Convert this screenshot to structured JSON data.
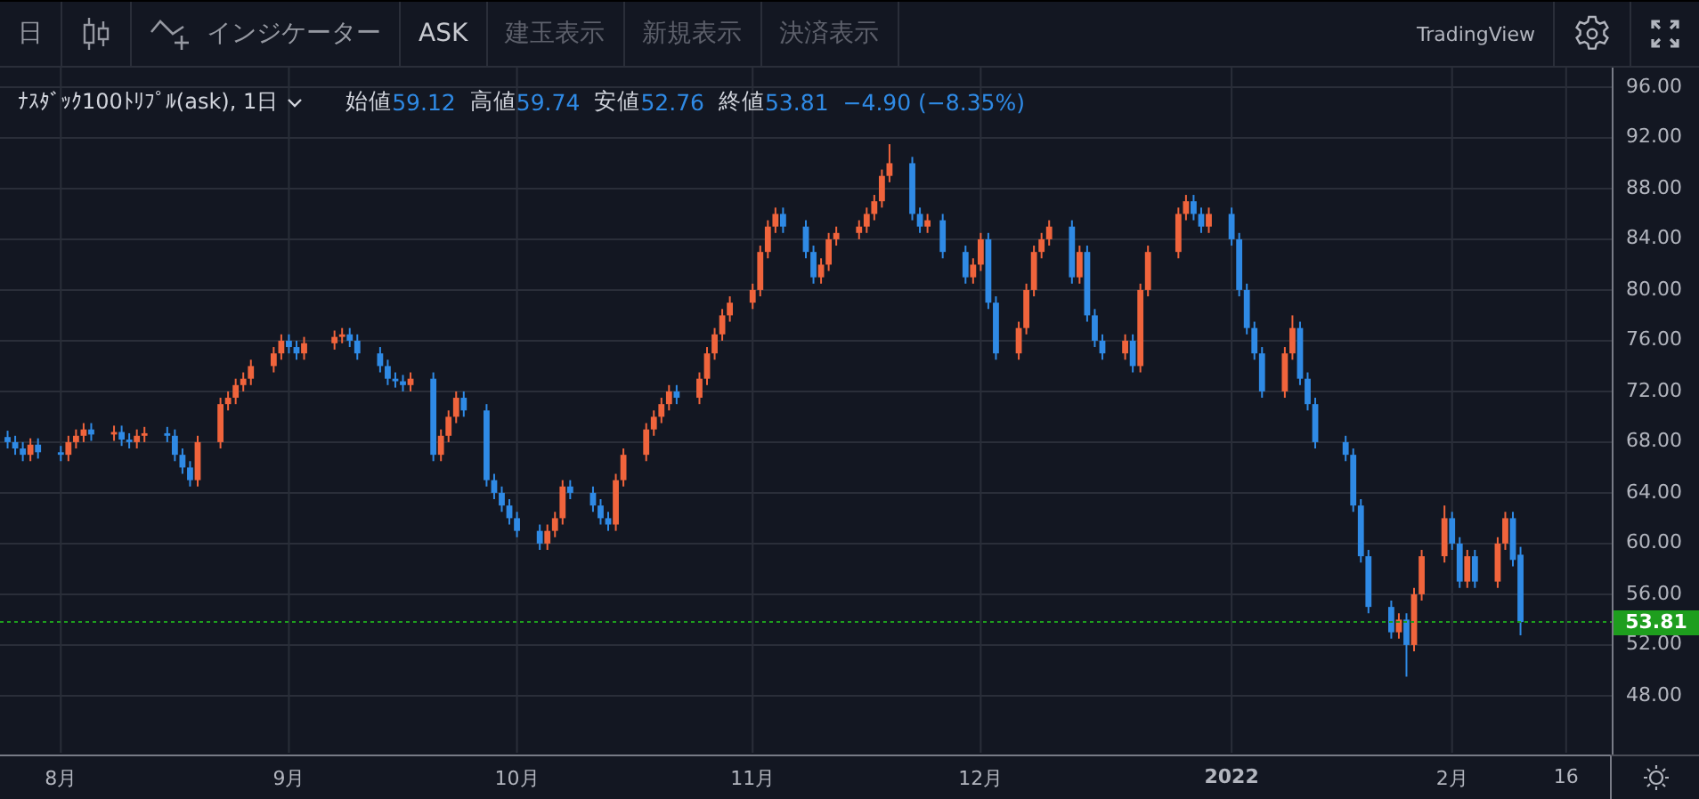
{
  "toolbar": {
    "items": [
      {
        "kind": "text",
        "label": "日"
      },
      {
        "kind": "icon"
      },
      {
        "kind": "indicator",
        "label": "インジケーター"
      },
      {
        "kind": "toggle",
        "label": "ASK",
        "selected": true
      },
      {
        "kind": "toggle",
        "label": "建玉表示",
        "selected": false
      },
      {
        "kind": "toggle",
        "label": "新規表示",
        "selected": false
      },
      {
        "kind": "toggle",
        "label": "決済表示",
        "selected": false
      }
    ],
    "brand": "TradingView"
  },
  "legend": {
    "symbol": "ﾅｽﾀﾞｯｸ100ﾄﾘﾌﾟﾙ(ask), 1日",
    "fields": [
      {
        "label": "始値",
        "value": "59.12"
      },
      {
        "label": "高値",
        "value": "59.74"
      },
      {
        "label": "安値",
        "value": "52.76"
      },
      {
        "label": "終値",
        "value": "53.81"
      }
    ],
    "change": "−4.90 (−8.35%)"
  },
  "chart_data": {
    "type": "candlestick",
    "xlim": [
      "2021-07-25",
      "2022-02-22"
    ],
    "ylim": [
      43.5,
      97.54
    ],
    "grid": true,
    "ref_lines": [
      {
        "axis": "y",
        "value": 53.81,
        "label": "53.81",
        "color": "#1e9e1e"
      }
    ],
    "yticks": [
      {
        "value": 48,
        "label": "48.00"
      },
      {
        "value": 52,
        "label": "52.00"
      },
      {
        "value": 56,
        "label": "56.00"
      },
      {
        "value": 60,
        "label": "60.00"
      },
      {
        "value": 64,
        "label": "64.00"
      },
      {
        "value": 68,
        "label": "68.00"
      },
      {
        "value": 72,
        "label": "72.00"
      },
      {
        "value": 76,
        "label": "76.00"
      },
      {
        "value": 80,
        "label": "80.00"
      },
      {
        "value": 84,
        "label": "84.00"
      },
      {
        "value": 88,
        "label": "88.00"
      },
      {
        "value": 92,
        "label": "92.00"
      },
      {
        "value": 96,
        "label": "96.00"
      }
    ],
    "xticks": [
      {
        "value": "2021-08-02",
        "label": "8月"
      },
      {
        "value": "2021-09-01",
        "label": "9月"
      },
      {
        "value": "2021-10-01",
        "label": "10月"
      },
      {
        "value": "2021-11-01",
        "label": "11月"
      },
      {
        "value": "2021-12-01",
        "label": "12月"
      },
      {
        "value": "2022-01-03",
        "label": "2022"
      },
      {
        "value": "2022-02-01",
        "label": "2月"
      },
      {
        "value": "2022-02-16",
        "label": "16"
      }
    ],
    "x": [
      "2021-07-26",
      "2021-07-27",
      "2021-07-28",
      "2021-07-29",
      "2021-07-30",
      "2021-08-02",
      "2021-08-03",
      "2021-08-04",
      "2021-08-05",
      "2021-08-06",
      "2021-08-09",
      "2021-08-10",
      "2021-08-11",
      "2021-08-12",
      "2021-08-13",
      "2021-08-16",
      "2021-08-17",
      "2021-08-18",
      "2021-08-19",
      "2021-08-20",
      "2021-08-23",
      "2021-08-24",
      "2021-08-25",
      "2021-08-26",
      "2021-08-27",
      "2021-08-30",
      "2021-08-31",
      "2021-09-01",
      "2021-09-02",
      "2021-09-03",
      "2021-09-07",
      "2021-09-08",
      "2021-09-09",
      "2021-09-10",
      "2021-09-13",
      "2021-09-14",
      "2021-09-15",
      "2021-09-16",
      "2021-09-17",
      "2021-09-20",
      "2021-09-21",
      "2021-09-22",
      "2021-09-23",
      "2021-09-24",
      "2021-09-27",
      "2021-09-28",
      "2021-09-29",
      "2021-09-30",
      "2021-10-01",
      "2021-10-04",
      "2021-10-05",
      "2021-10-06",
      "2021-10-07",
      "2021-10-08",
      "2021-10-11",
      "2021-10-12",
      "2021-10-13",
      "2021-10-14",
      "2021-10-15",
      "2021-10-18",
      "2021-10-19",
      "2021-10-20",
      "2021-10-21",
      "2021-10-22",
      "2021-10-25",
      "2021-10-26",
      "2021-10-27",
      "2021-10-28",
      "2021-10-29",
      "2021-11-01",
      "2021-11-02",
      "2021-11-03",
      "2021-11-04",
      "2021-11-05",
      "2021-11-08",
      "2021-11-09",
      "2021-11-10",
      "2021-11-11",
      "2021-11-12",
      "2021-11-15",
      "2021-11-16",
      "2021-11-17",
      "2021-11-18",
      "2021-11-19",
      "2021-11-22",
      "2021-11-23",
      "2021-11-24",
      "2021-11-26",
      "2021-11-29",
      "2021-11-30",
      "2021-12-01",
      "2021-12-02",
      "2021-12-03",
      "2021-12-06",
      "2021-12-07",
      "2021-12-08",
      "2021-12-09",
      "2021-12-10",
      "2021-12-13",
      "2021-12-14",
      "2021-12-15",
      "2021-12-16",
      "2021-12-17",
      "2021-12-20",
      "2021-12-21",
      "2021-12-22",
      "2021-12-23",
      "2021-12-27",
      "2021-12-28",
      "2021-12-29",
      "2021-12-30",
      "2021-12-31",
      "2022-01-03",
      "2022-01-04",
      "2022-01-05",
      "2022-01-06",
      "2022-01-07",
      "2022-01-10",
      "2022-01-11",
      "2022-01-12",
      "2022-01-13",
      "2022-01-14",
      "2022-01-18",
      "2022-01-19",
      "2022-01-20",
      "2022-01-21",
      "2022-01-24",
      "2022-01-25",
      "2022-01-26",
      "2022-01-27",
      "2022-01-28",
      "2022-01-31",
      "2022-02-01",
      "2022-02-02",
      "2022-02-03",
      "2022-02-04",
      "2022-02-07",
      "2022-02-08",
      "2022-02-09",
      "2022-02-10"
    ],
    "ohlc": [
      [
        68.4,
        68.9,
        67.5,
        68
      ],
      [
        68,
        68.5,
        67,
        67.5
      ],
      [
        67.5,
        68,
        66.5,
        67
      ],
      [
        67,
        68.3,
        66.5,
        67.8
      ],
      [
        67.8,
        68.3,
        66.7,
        67.2
      ],
      [
        67.2,
        67.7,
        66.5,
        67
      ],
      [
        67,
        68.5,
        66.5,
        68
      ],
      [
        68,
        69,
        67.5,
        68.5
      ],
      [
        68.5,
        69.5,
        68,
        69
      ],
      [
        69,
        69.5,
        68.1,
        68.6
      ],
      [
        68.6,
        69.3,
        68.1,
        68.8
      ],
      [
        68.8,
        69.3,
        67.7,
        68.2
      ],
      [
        68.2,
        68.7,
        67.5,
        68
      ],
      [
        68,
        69,
        67.5,
        68.5
      ],
      [
        68.5,
        69.2,
        68,
        68.7
      ],
      [
        68.7,
        69.2,
        68,
        68.5
      ],
      [
        68.5,
        69,
        66.5,
        67
      ],
      [
        67,
        67.5,
        65.5,
        66
      ],
      [
        66,
        66.5,
        64.5,
        65
      ],
      [
        65,
        68.5,
        64.5,
        68
      ],
      [
        68,
        71.5,
        67.5,
        71
      ],
      [
        71,
        72,
        70.5,
        71.5
      ],
      [
        71.5,
        73,
        71,
        72.5
      ],
      [
        72.5,
        73.5,
        72,
        73
      ],
      [
        73,
        74.5,
        72.5,
        74
      ],
      [
        74,
        75.5,
        73.5,
        75
      ],
      [
        75,
        76.5,
        74.5,
        76
      ],
      [
        76,
        76.5,
        75,
        75.5
      ],
      [
        75.5,
        76,
        74.5,
        75
      ],
      [
        75,
        76.3,
        74.5,
        75.8
      ],
      [
        75.8,
        76.8,
        75.3,
        76.3
      ],
      [
        76.3,
        77,
        75.8,
        76.5
      ],
      [
        76.5,
        77,
        75.5,
        76
      ],
      [
        76,
        76.5,
        74.5,
        75
      ],
      [
        75,
        75.5,
        73.5,
        74
      ],
      [
        74,
        74.5,
        72.5,
        73
      ],
      [
        73,
        73.5,
        72.3,
        72.8
      ],
      [
        72.8,
        73.3,
        72,
        72.5
      ],
      [
        72.5,
        73.5,
        72,
        73
      ],
      [
        73,
        73.5,
        66.5,
        67
      ],
      [
        67,
        69,
        66.5,
        68.5
      ],
      [
        68.5,
        70.5,
        68,
        70
      ],
      [
        70,
        72,
        69.5,
        71.5
      ],
      [
        71.5,
        72,
        70,
        70.5
      ],
      [
        70.5,
        71,
        64.5,
        65
      ],
      [
        65,
        65.5,
        63.5,
        64
      ],
      [
        64,
        64.5,
        62.5,
        63
      ],
      [
        63,
        63.5,
        61.5,
        62
      ],
      [
        62,
        62.5,
        60.5,
        61
      ],
      [
        61,
        61.5,
        59.5,
        60
      ],
      [
        60,
        61.5,
        59.5,
        61
      ],
      [
        61,
        62.5,
        60.5,
        62
      ],
      [
        62,
        65,
        61.5,
        64.5
      ],
      [
        64.5,
        65,
        63.5,
        64
      ],
      [
        64,
        64.5,
        62.5,
        63
      ],
      [
        63,
        63.5,
        61.5,
        62
      ],
      [
        62,
        62.5,
        61,
        61.5
      ],
      [
        61.5,
        65.5,
        61,
        65
      ],
      [
        65,
        67.5,
        64.5,
        67
      ],
      [
        67,
        69.5,
        66.5,
        69
      ],
      [
        69,
        70.5,
        68.5,
        70
      ],
      [
        70,
        71.5,
        69.5,
        71
      ],
      [
        71,
        72.5,
        70.5,
        72
      ],
      [
        72,
        72.5,
        71,
        71.5
      ],
      [
        71.5,
        73.5,
        71,
        73
      ],
      [
        73,
        75.5,
        72.5,
        75
      ],
      [
        75,
        77,
        74.5,
        76.5
      ],
      [
        76.5,
        78.5,
        76,
        78
      ],
      [
        78,
        79.5,
        77.5,
        79
      ],
      [
        79,
        80.5,
        78.5,
        80
      ],
      [
        80,
        83.5,
        79.5,
        83
      ],
      [
        83,
        85.5,
        82.5,
        85
      ],
      [
        85,
        86.5,
        84.5,
        86
      ],
      [
        86,
        86.5,
        84.5,
        85
      ],
      [
        85,
        85.5,
        82.5,
        83
      ],
      [
        83,
        83.5,
        80.5,
        81
      ],
      [
        81,
        82.5,
        80.5,
        82
      ],
      [
        82,
        84.5,
        81.5,
        84
      ],
      [
        84,
        85,
        83.5,
        84.5
      ],
      [
        84.5,
        85.5,
        84,
        85
      ],
      [
        85,
        86.5,
        84.5,
        86
      ],
      [
        86,
        87.5,
        85.5,
        87
      ],
      [
        87,
        89.5,
        86.5,
        89
      ],
      [
        89,
        91.5,
        88.5,
        90
      ],
      [
        90,
        90.5,
        85.5,
        86
      ],
      [
        86,
        86.5,
        84.5,
        85
      ],
      [
        85,
        86,
        84.5,
        85.5
      ],
      [
        85.5,
        86,
        82.5,
        83
      ],
      [
        83,
        83.5,
        80.5,
        81
      ],
      [
        81,
        82.5,
        80.5,
        82
      ],
      [
        82,
        84.5,
        81.5,
        84
      ],
      [
        84,
        84.5,
        78.5,
        79
      ],
      [
        79,
        79.5,
        74.5,
        75
      ],
      [
        75,
        77.5,
        74.5,
        77
      ],
      [
        77,
        80.5,
        76.5,
        80
      ],
      [
        80,
        83.5,
        79.5,
        83
      ],
      [
        83,
        84.5,
        82.5,
        84
      ],
      [
        84,
        85.5,
        83.5,
        85
      ],
      [
        85,
        85.5,
        80.5,
        81
      ],
      [
        81,
        83.5,
        80.5,
        83
      ],
      [
        83,
        83.5,
        77.5,
        78
      ],
      [
        78,
        78.5,
        75.5,
        76
      ],
      [
        76,
        76.5,
        74.5,
        75
      ],
      [
        75,
        76.5,
        74.5,
        76
      ],
      [
        76,
        76.5,
        73.5,
        74
      ],
      [
        74,
        80.5,
        73.5,
        80
      ],
      [
        80,
        83.5,
        79.5,
        83
      ],
      [
        83,
        86.5,
        82.5,
        86
      ],
      [
        86,
        87.5,
        85.5,
        87
      ],
      [
        87,
        87.5,
        85.5,
        86
      ],
      [
        86,
        86.5,
        84.5,
        85
      ],
      [
        85,
        86.5,
        84.5,
        86
      ],
      [
        86,
        86.5,
        83.5,
        84
      ],
      [
        84,
        84.5,
        79.5,
        80
      ],
      [
        80,
        80.5,
        76.5,
        77
      ],
      [
        77,
        77.5,
        74.5,
        75
      ],
      [
        75,
        75.5,
        71.5,
        72
      ],
      [
        72,
        75.5,
        71.5,
        75
      ],
      [
        75,
        78,
        74.5,
        77
      ],
      [
        77,
        77.5,
        72.5,
        73
      ],
      [
        73,
        73.5,
        70.5,
        71
      ],
      [
        71,
        71.5,
        67.5,
        68
      ],
      [
        68,
        68.5,
        66.5,
        67
      ],
      [
        67,
        67.5,
        62.5,
        63
      ],
      [
        63,
        63.5,
        58.5,
        59
      ],
      [
        59,
        59.5,
        54.5,
        55
      ],
      [
        55,
        55.5,
        52.5,
        53
      ],
      [
        53,
        54.5,
        52.5,
        54
      ],
      [
        54,
        54.5,
        49.5,
        52
      ],
      [
        52,
        56.5,
        51.5,
        56
      ],
      [
        56,
        59.5,
        55.5,
        59
      ],
      [
        59,
        63,
        58.5,
        62
      ],
      [
        62,
        62.5,
        59.5,
        60
      ],
      [
        60,
        60.5,
        56.5,
        57
      ],
      [
        57,
        59.5,
        56.5,
        59
      ],
      [
        59,
        59.5,
        56.5,
        57
      ],
      [
        57,
        60.5,
        56.5,
        60
      ],
      [
        60,
        62.5,
        59.5,
        62
      ],
      [
        62,
        62.5,
        58.2,
        58.71
      ],
      [
        59.12,
        59.74,
        52.76,
        53.81
      ]
    ]
  }
}
